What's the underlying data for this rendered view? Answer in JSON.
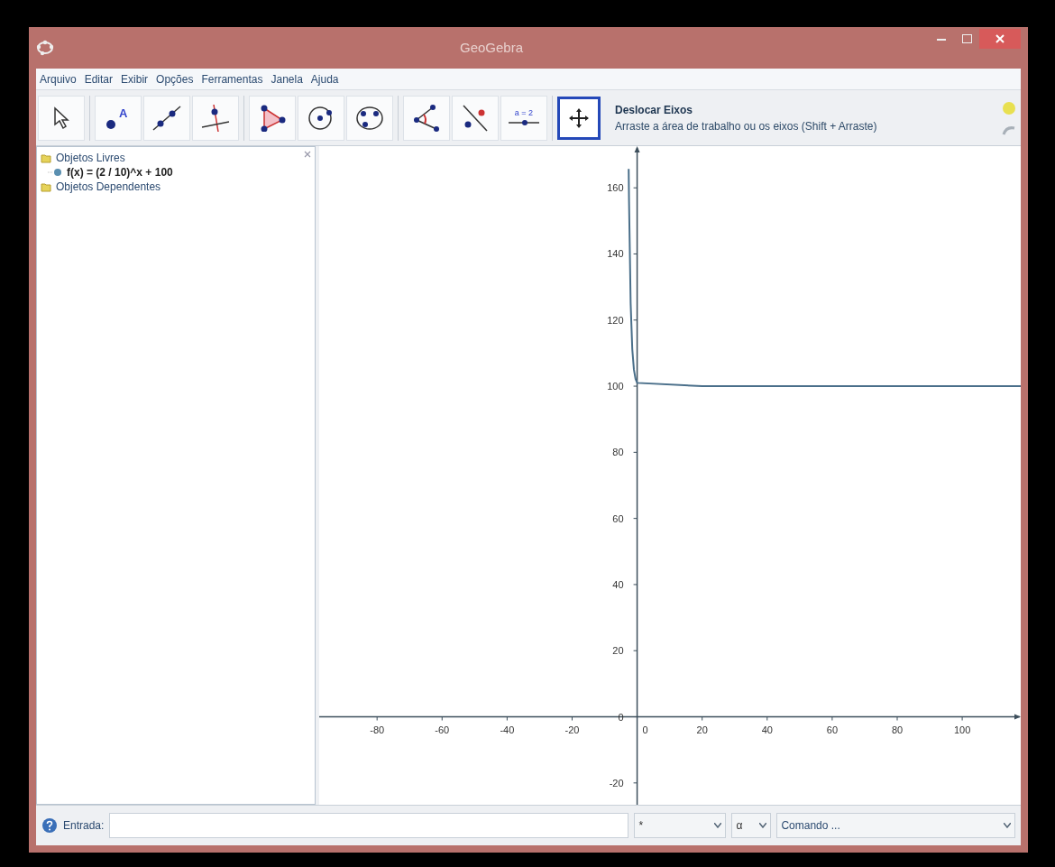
{
  "window": {
    "title": "GeoGebra"
  },
  "menu": [
    "Arquivo",
    "Editar",
    "Exibir",
    "Opções",
    "Ferramentas",
    "Janela",
    "Ajuda"
  ],
  "toolbar": {
    "tools": [
      {
        "kind": "move",
        "selected": false
      },
      {
        "kind": "point",
        "selected": false,
        "label": "A"
      },
      {
        "kind": "line",
        "selected": false
      },
      {
        "kind": "perpendicular",
        "selected": false
      },
      {
        "kind": "polygon",
        "selected": false
      },
      {
        "kind": "circle",
        "selected": false
      },
      {
        "kind": "conic",
        "selected": false
      },
      {
        "kind": "angle",
        "selected": false
      },
      {
        "kind": "reflect",
        "selected": false
      },
      {
        "kind": "slider",
        "selected": false,
        "label": "a = 2"
      },
      {
        "kind": "move-view",
        "selected": true
      }
    ],
    "tool_title": "Deslocar Eixos",
    "tool_help": "Arraste a área de trabalho ou os eixos (Shift + Arraste)"
  },
  "algebra": {
    "items": [
      {
        "label": "Objetos Livres",
        "expanded": true,
        "children": [
          {
            "label": "f(x) = (2 / 10)^x + 100"
          }
        ]
      },
      {
        "label": "Objetos Dependentes",
        "expanded": true
      }
    ]
  },
  "graphics": {
    "chart_data": {
      "type": "line",
      "x": [
        -2.6,
        -2.5,
        -2,
        -1.5,
        -1,
        -0.5,
        0,
        20,
        40,
        60,
        80,
        100,
        118
      ],
      "series": [
        {
          "color": "#4a6f8a",
          "values": [
            165.7,
            155.9,
            125,
            111.2,
            105,
            102.2,
            101,
            100,
            100,
            100,
            100,
            100,
            100
          ]
        }
      ],
      "xlim": [
        -97.8,
        118
      ],
      "ylim": [
        -26.6,
        172.6
      ],
      "xticks": [
        -80,
        -60,
        -40,
        -20,
        20,
        40,
        60,
        80,
        100
      ],
      "yticks": [
        -20,
        0,
        20,
        40,
        60,
        80,
        100,
        120,
        140,
        160
      ]
    },
    "origin_label": "0"
  },
  "input_bar": {
    "label": "Entrada:",
    "symbol": "*",
    "greek": "α",
    "command": "Comando ..."
  }
}
